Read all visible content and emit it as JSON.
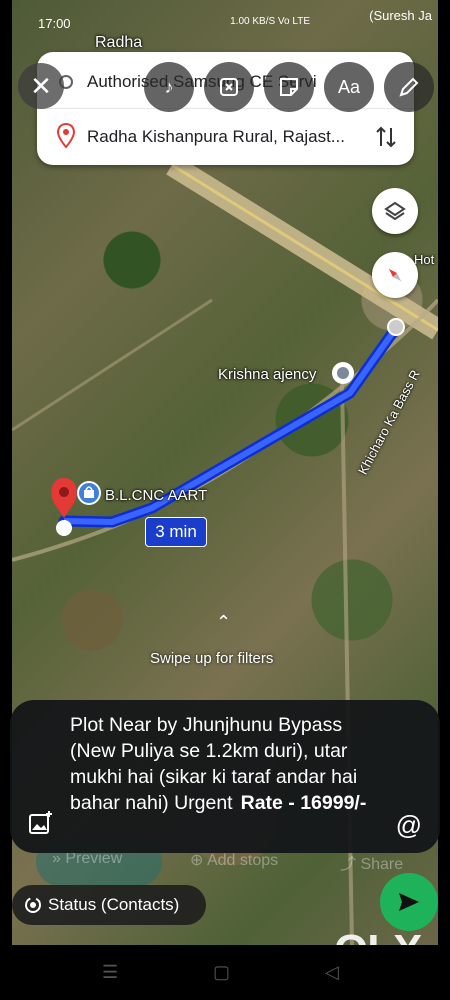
{
  "status_bar": {
    "time": "17:00",
    "network": "1.00 KB/S  Vo LTE",
    "corner_label": "(Suresh Ja"
  },
  "map": {
    "place_labels": {
      "top": "Radha",
      "krishna": "Krishna ajency",
      "road": "Khicharo Ka Bass R",
      "business": "B.L.CNC AART",
      "hot": "Hot"
    },
    "duration": "3 min",
    "swipe_hint": "Swipe up for filters"
  },
  "directions": {
    "origin": "Authorised Samsung CE Servi",
    "destination": "Radha Kishanpura Rural, Rajast..."
  },
  "editor_tools": [
    "music-icon",
    "sticker-crop-icon",
    "sticker-icon",
    "text-icon",
    "pencil-icon"
  ],
  "editor_text_tool": "Aa",
  "caption": {
    "text": "Plot Near by Jhunjhunu Bypass (New Puliya se 1.2km duri), utar mukhi hai (sikar ki taraf andar hai bahar nahi) Urgent",
    "rate": "Rate - 16999/-"
  },
  "behind_actions": {
    "preview": "Preview",
    "add_stops": "Add stops",
    "share": "Share"
  },
  "status_contacts": "Status (Contacts)",
  "watermark": "OLX",
  "colors": {
    "route": "#1a3ecb",
    "send": "#1eb35a",
    "pin": "#e53935"
  }
}
